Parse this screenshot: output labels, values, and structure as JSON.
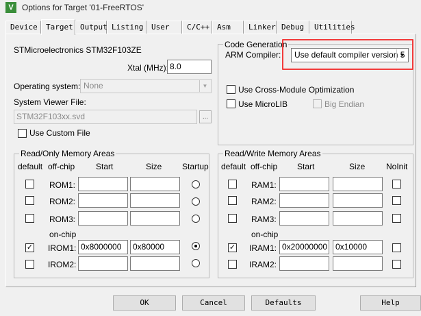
{
  "window": {
    "title": "Options for Target '01-FreeRTOS'",
    "icon_letter": "V"
  },
  "tabs": [
    "Device",
    "Target",
    "Output",
    "Listing",
    "User",
    "C/C++",
    "Asm",
    "Linker",
    "Debug",
    "Utilities"
  ],
  "target": {
    "device_name": "STMicroelectronics STM32F103ZE",
    "xtal_label": "Xtal (MHz):",
    "xtal_value": "8.0",
    "os_label": "Operating system:",
    "os_value": "None",
    "svd_label": "System Viewer File:",
    "svd_value": "STM32F103xx.svd",
    "browse_label": "...",
    "custom_file_label": "Use Custom File"
  },
  "code_generation": {
    "title": "Code Generation",
    "compiler_label": "ARM Compiler:",
    "compiler_value": "Use default compiler version 5",
    "cross_module_label": "Use Cross-Module Optimization",
    "microlib_label": "Use MicroLIB",
    "big_endian_label": "Big Endian",
    "highlight_color": "#f23b3b"
  },
  "ro_memory": {
    "title": "Read/Only Memory Areas",
    "headers": {
      "default": "default",
      "offchip": "off-chip",
      "start": "Start",
      "size": "Size",
      "startup": "Startup"
    },
    "onchip_label": "on-chip",
    "rows": [
      {
        "name": "ROM1:",
        "start": "",
        "size": "",
        "default": false,
        "startup": false
      },
      {
        "name": "ROM2:",
        "start": "",
        "size": "",
        "default": false,
        "startup": false
      },
      {
        "name": "ROM3:",
        "start": "",
        "size": "",
        "default": false,
        "startup": false
      },
      {
        "name": "IROM1:",
        "start": "0x8000000",
        "size": "0x80000",
        "default": true,
        "startup": true
      },
      {
        "name": "IROM2:",
        "start": "",
        "size": "",
        "default": false,
        "startup": false
      }
    ]
  },
  "rw_memory": {
    "title": "Read/Write Memory Areas",
    "headers": {
      "default": "default",
      "offchip": "off-chip",
      "start": "Start",
      "size": "Size",
      "noinit": "NoInit"
    },
    "onchip_label": "on-chip",
    "rows": [
      {
        "name": "RAM1:",
        "start": "",
        "size": "",
        "default": false,
        "noinit": false
      },
      {
        "name": "RAM2:",
        "start": "",
        "size": "",
        "default": false,
        "noinit": false
      },
      {
        "name": "RAM3:",
        "start": "",
        "size": "",
        "default": false,
        "noinit": false
      },
      {
        "name": "IRAM1:",
        "start": "0x20000000",
        "size": "0x10000",
        "default": true,
        "noinit": false
      },
      {
        "name": "IRAM2:",
        "start": "",
        "size": "",
        "default": false,
        "noinit": false
      }
    ]
  },
  "buttons": {
    "ok": "OK",
    "cancel": "Cancel",
    "defaults": "Defaults",
    "help": "Help"
  },
  "check_glyph": "✓",
  "arrow_glyph": "▼"
}
